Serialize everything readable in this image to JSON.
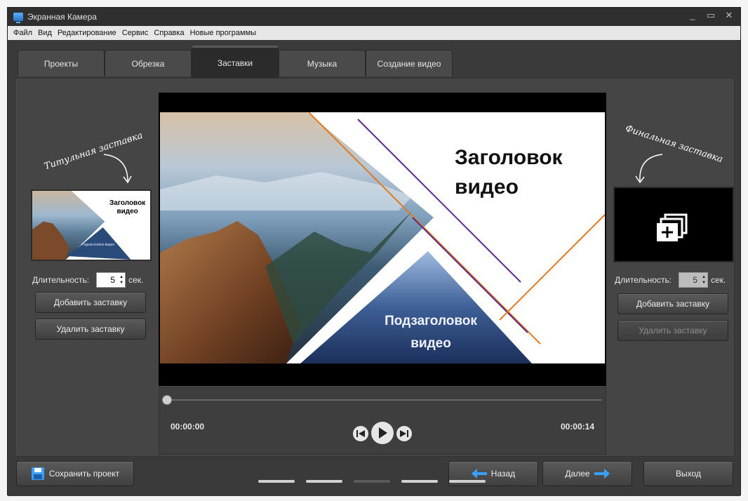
{
  "window": {
    "title": "Экранная Камера",
    "controls": [
      "_",
      "▭",
      "✕"
    ]
  },
  "menu": [
    "Файл",
    "Вид",
    "Редактирование",
    "Сервис",
    "Справка",
    "Новые программы"
  ],
  "tabs": [
    {
      "label": "Проекты"
    },
    {
      "label": "Обрезка"
    },
    {
      "label": "Заставки"
    },
    {
      "label": "Музыка"
    },
    {
      "label": "Создание видео"
    }
  ],
  "left_panel": {
    "caption": "Титульная заставка",
    "duration_label": "Длительность:",
    "duration_value": "5",
    "duration_unit": "сек.",
    "add_button": "Добавить заставку",
    "remove_button": "Удалить заставку",
    "thumb_title": "Заголовок\nвидео",
    "thumb_subtitle": "Подзаголовок видео"
  },
  "right_panel": {
    "caption": "Финальная заставка",
    "duration_label": "Длительность:",
    "duration_value": "5",
    "duration_unit": "сек.",
    "add_button": "Добавить заставку",
    "remove_button": "Удалить заставку"
  },
  "preview": {
    "title_line1": "Заголовок",
    "title_line2": "видео",
    "subtitle_line1": "Подзаголовок",
    "subtitle_line2": "видео"
  },
  "player": {
    "current_time": "00:00:00",
    "total_time": "00:00:14",
    "progress": 0
  },
  "footer": {
    "save_button": "Сохранить проект",
    "back_button": "Назад",
    "next_button": "Далее",
    "exit_button": "Выход"
  },
  "colors": {
    "accent_blue": "#3aa0ff",
    "line_orange": "#e07a1f",
    "line_purple": "#5b2a86"
  }
}
